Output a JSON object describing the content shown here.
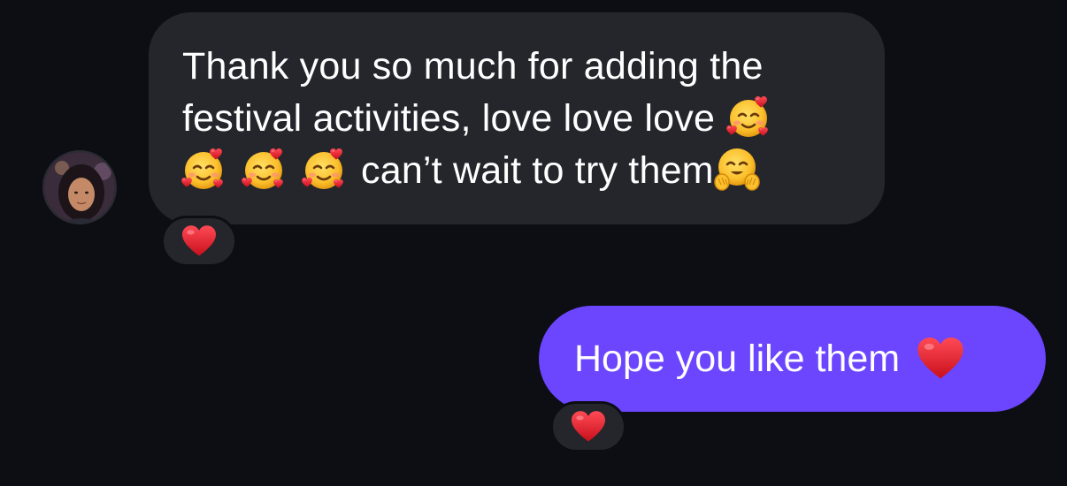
{
  "incoming": {
    "line1": "Thank you so much for adding the",
    "line2": "festival activities, love love love",
    "line3": "can’t wait to try them",
    "emojis": [
      "smiling-face-with-hearts-icon",
      "hugging-face-icon"
    ],
    "reaction": "heart-icon"
  },
  "outgoing": {
    "text": "Hope you like them",
    "emoji": "red-heart-icon",
    "reaction": "heart-icon"
  },
  "colors": {
    "background": "#0c0e14",
    "incoming_bubble": "#24262c",
    "outgoing_bubble": "#6c45ff",
    "heart": "#e8202e"
  }
}
